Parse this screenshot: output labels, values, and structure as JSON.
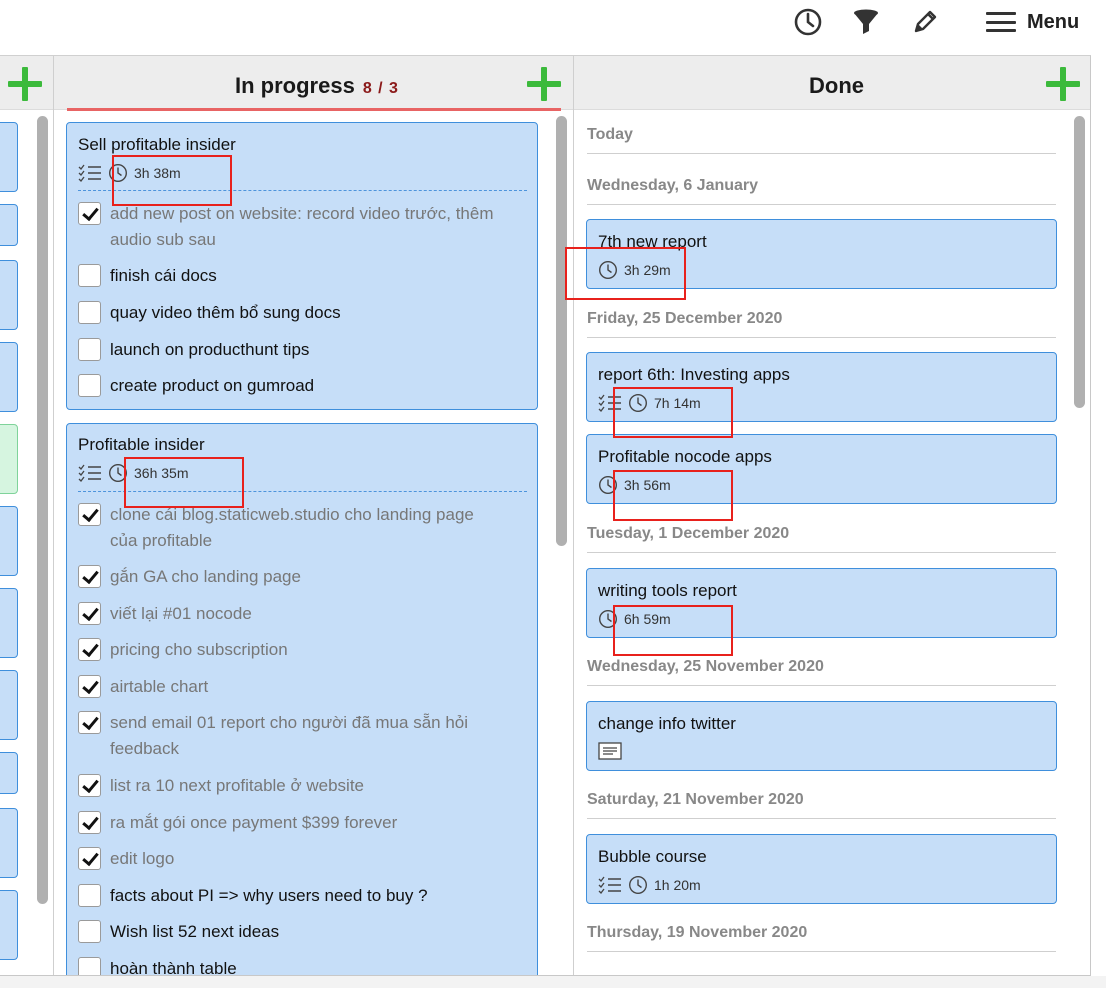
{
  "toolbar": {
    "icons": [
      "history-icon",
      "filter-icon",
      "pencil-icon"
    ],
    "menu_label": "Menu"
  },
  "columns": {
    "in_progress": {
      "title": "In progress",
      "wip": "8 / 3"
    },
    "done": {
      "title": "Done"
    }
  },
  "cards": {
    "sell": {
      "title": "Sell profitable insider",
      "time": "3h 38m",
      "items": [
        {
          "text": "add new post on website: record video trước, thêm",
          "text2": "audio sub sau",
          "checked": true
        },
        {
          "text": "finish cái docs",
          "checked": false
        },
        {
          "text": "quay video thêm bổ sung docs",
          "checked": false
        },
        {
          "text": "launch on producthunt tips",
          "checked": false
        },
        {
          "text": "create product on gumroad",
          "checked": false
        }
      ]
    },
    "insider": {
      "title": "Profitable insider",
      "time": "36h 35m",
      "items": [
        {
          "text": "clone cái blog.staticweb.studio cho landing page",
          "text2": "của profitable",
          "checked": true
        },
        {
          "text": "gắn GA cho landing page",
          "checked": true
        },
        {
          "text": "viết lại #01 nocode",
          "checked": true
        },
        {
          "text": "pricing cho subscription",
          "checked": true
        },
        {
          "text": "airtable chart",
          "checked": true
        },
        {
          "text": "send email 01 report cho người đã mua sẵn hỏi",
          "text2": "feedback",
          "checked": true
        },
        {
          "text": "list ra 10 next profitable ở website",
          "checked": true
        },
        {
          "text": "ra mắt gói once payment $399 forever",
          "checked": true
        },
        {
          "text": "edit logo",
          "checked": true
        },
        {
          "text": "facts about PI => why users need to buy ?",
          "checked": false
        },
        {
          "text": "Wish list 52 next ideas",
          "checked": false
        },
        {
          "text": "hoàn thành table",
          "checked": false
        }
      ]
    }
  },
  "done": {
    "days": [
      "Today",
      "Wednesday, 6 January",
      "Friday, 25 December 2020",
      "Tuesday, 1 December 2020",
      "Wednesday, 25 November 2020",
      "Saturday, 21 November 2020",
      "Thursday, 19 November 2020"
    ],
    "cards": [
      {
        "title": "7th new report",
        "time": "3h 29m"
      },
      {
        "title": "report 6th: Investing apps",
        "time": "7h 14m"
      },
      {
        "title": "Profitable nocode apps",
        "time": "3h 56m"
      },
      {
        "title": "writing tools report",
        "time": "6h 59m"
      },
      {
        "title": "change info twitter"
      },
      {
        "title": "Bubble course",
        "time": "1h 20m"
      }
    ]
  }
}
